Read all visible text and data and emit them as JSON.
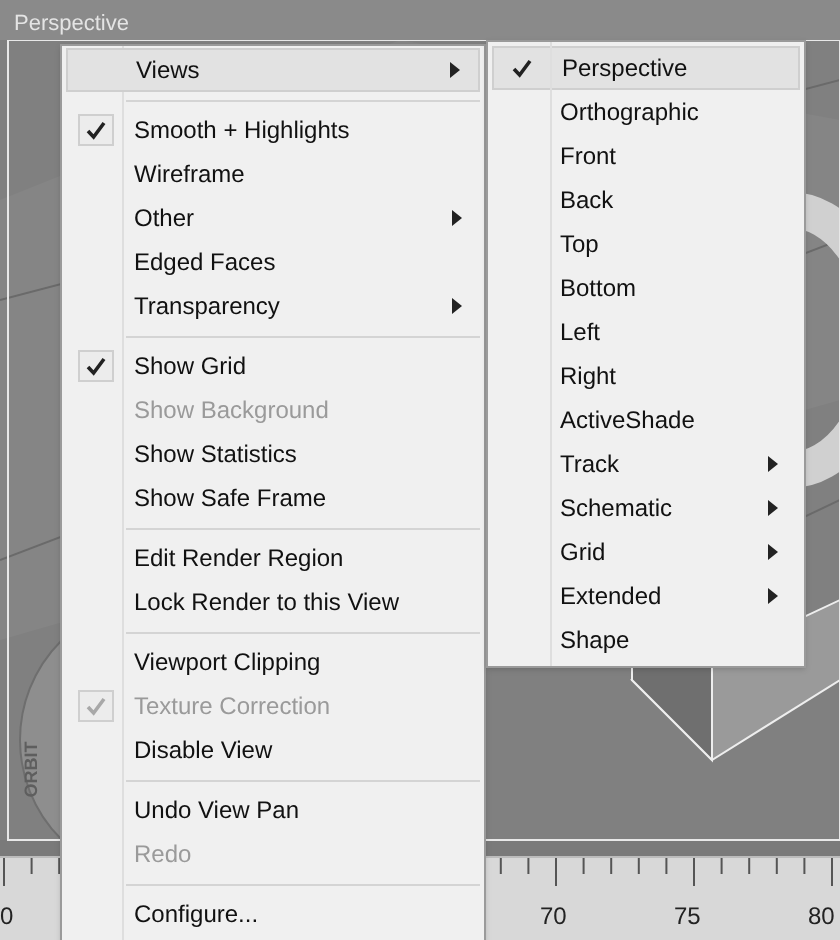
{
  "viewport": {
    "label": "Perspective",
    "orbit_label": "ORBIT"
  },
  "menu": {
    "items": [
      {
        "kind": "item",
        "label": "Views",
        "checked": false,
        "disabled": false,
        "submenu": true,
        "selected": true
      },
      {
        "kind": "separator"
      },
      {
        "kind": "item",
        "label": "Smooth + Highlights",
        "checked": true,
        "disabled": false,
        "submenu": false,
        "selected": false
      },
      {
        "kind": "item",
        "label": "Wireframe",
        "checked": false,
        "disabled": false,
        "submenu": false,
        "selected": false
      },
      {
        "kind": "item",
        "label": "Other",
        "checked": false,
        "disabled": false,
        "submenu": true,
        "selected": false
      },
      {
        "kind": "item",
        "label": "Edged Faces",
        "checked": false,
        "disabled": false,
        "submenu": false,
        "selected": false
      },
      {
        "kind": "item",
        "label": "Transparency",
        "checked": false,
        "disabled": false,
        "submenu": true,
        "selected": false
      },
      {
        "kind": "separator"
      },
      {
        "kind": "item",
        "label": "Show Grid",
        "checked": true,
        "disabled": false,
        "submenu": false,
        "selected": false
      },
      {
        "kind": "item",
        "label": "Show Background",
        "checked": false,
        "disabled": true,
        "submenu": false,
        "selected": false
      },
      {
        "kind": "item",
        "label": "Show Statistics",
        "checked": false,
        "disabled": false,
        "submenu": false,
        "selected": false
      },
      {
        "kind": "item",
        "label": "Show Safe Frame",
        "checked": false,
        "disabled": false,
        "submenu": false,
        "selected": false
      },
      {
        "kind": "separator"
      },
      {
        "kind": "item",
        "label": "Edit Render Region",
        "checked": false,
        "disabled": false,
        "submenu": false,
        "selected": false
      },
      {
        "kind": "item",
        "label": "Lock Render to this View",
        "checked": false,
        "disabled": false,
        "submenu": false,
        "selected": false
      },
      {
        "kind": "separator"
      },
      {
        "kind": "item",
        "label": "Viewport Clipping",
        "checked": false,
        "disabled": false,
        "submenu": false,
        "selected": false
      },
      {
        "kind": "item",
        "label": "Texture Correction",
        "checked": true,
        "disabled": true,
        "submenu": false,
        "selected": false
      },
      {
        "kind": "item",
        "label": "Disable View",
        "checked": false,
        "disabled": false,
        "submenu": false,
        "selected": false
      },
      {
        "kind": "separator"
      },
      {
        "kind": "item",
        "label": "Undo View Pan",
        "checked": false,
        "disabled": false,
        "submenu": false,
        "selected": false
      },
      {
        "kind": "item",
        "label": "Redo",
        "checked": false,
        "disabled": true,
        "submenu": false,
        "selected": false
      },
      {
        "kind": "separator"
      },
      {
        "kind": "item",
        "label": "Configure...",
        "checked": false,
        "disabled": false,
        "submenu": false,
        "selected": false
      }
    ]
  },
  "submenu": {
    "items": [
      {
        "label": "Perspective",
        "checked": true,
        "submenu": false,
        "selected": true
      },
      {
        "label": "Orthographic",
        "checked": false,
        "submenu": false,
        "selected": false
      },
      {
        "label": "Front",
        "checked": false,
        "submenu": false,
        "selected": false
      },
      {
        "label": "Back",
        "checked": false,
        "submenu": false,
        "selected": false
      },
      {
        "label": "Top",
        "checked": false,
        "submenu": false,
        "selected": false
      },
      {
        "label": "Bottom",
        "checked": false,
        "submenu": false,
        "selected": false
      },
      {
        "label": "Left",
        "checked": false,
        "submenu": false,
        "selected": false
      },
      {
        "label": "Right",
        "checked": false,
        "submenu": false,
        "selected": false
      },
      {
        "label": "ActiveShade",
        "checked": false,
        "submenu": false,
        "selected": false
      },
      {
        "label": "Track",
        "checked": false,
        "submenu": true,
        "selected": false
      },
      {
        "label": "Schematic",
        "checked": false,
        "submenu": true,
        "selected": false
      },
      {
        "label": "Grid",
        "checked": false,
        "submenu": true,
        "selected": false
      },
      {
        "label": "Extended",
        "checked": false,
        "submenu": true,
        "selected": false
      },
      {
        "label": "Shape",
        "checked": false,
        "submenu": false,
        "selected": false
      }
    ]
  },
  "ruler": {
    "labels": [
      "0",
      "70",
      "75",
      "80"
    ]
  }
}
